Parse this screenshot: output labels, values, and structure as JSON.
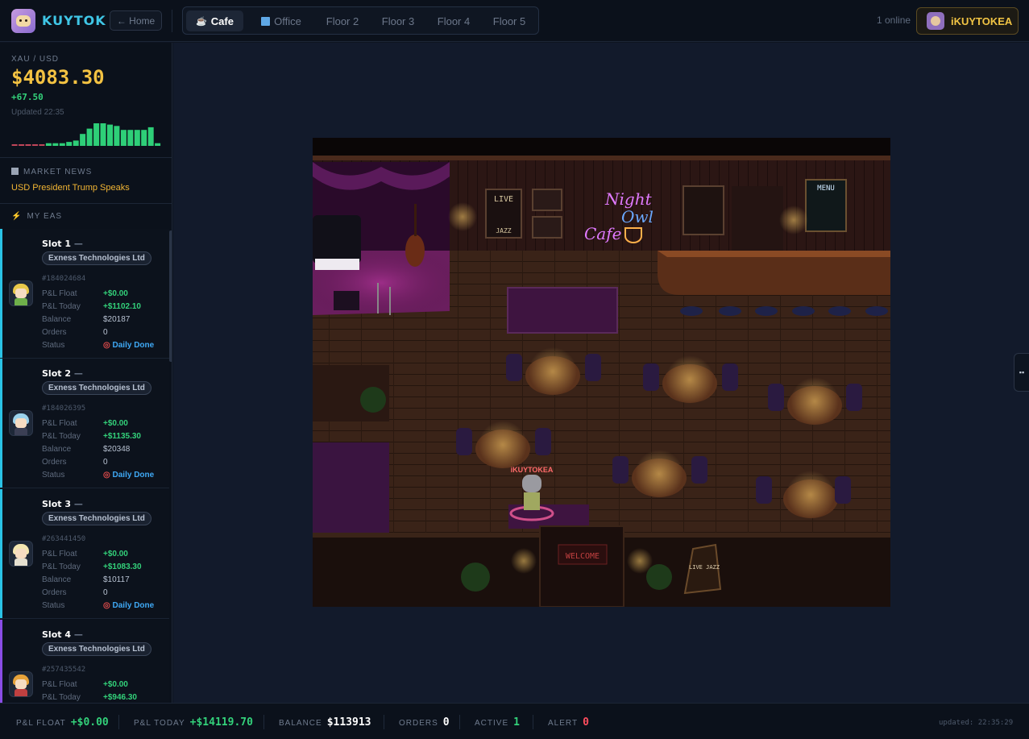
{
  "header": {
    "brand": "KUYTOK",
    "home_label": "← Home",
    "tabs": [
      {
        "label": "Cafe",
        "icon": "coffee-icon",
        "active": true
      },
      {
        "label": "Office",
        "icon": "building-icon"
      },
      {
        "label": "Floor 2"
      },
      {
        "label": "Floor 3"
      },
      {
        "label": "Floor 4"
      },
      {
        "label": "Floor 5"
      }
    ],
    "online": "1 online",
    "username": "iKUYTOKEA"
  },
  "ticker": {
    "symbol": "XAU / USD",
    "price": "$4083.30",
    "change": "+67.50",
    "updated": "Updated 22:35",
    "spark_values": [
      1,
      1,
      1,
      1,
      1,
      2,
      2,
      2,
      3,
      4,
      9,
      13,
      17,
      17,
      16,
      15,
      12,
      12,
      12,
      12,
      14,
      2
    ],
    "spark_colors": {
      "down": "#c0465a",
      "up": "#2ecf78"
    }
  },
  "news": {
    "title": "MARKET NEWS",
    "headline": "USD President Trump Speaks"
  },
  "eas": {
    "title": "MY EAS",
    "labels": {
      "float": "P&L Float",
      "today": "P&L Today",
      "balance": "Balance",
      "orders": "Orders",
      "status": "Status"
    },
    "slots": [
      {
        "name": "Slot 1",
        "broker": "Exness Technologies Ltd",
        "account": "#184024684",
        "float": "+$0.00",
        "today": "+$1102.10",
        "balance": "$20187",
        "orders": "0",
        "status": "Daily Done",
        "accent": "#2ac3e6"
      },
      {
        "name": "Slot 2",
        "broker": "Exness Technologies Ltd",
        "account": "#184026395",
        "float": "+$0.00",
        "today": "+$1135.30",
        "balance": "$20348",
        "orders": "0",
        "status": "Daily Done",
        "accent": "#2ac3e6"
      },
      {
        "name": "Slot 3",
        "broker": "Exness Technologies Ltd",
        "account": "#263441450",
        "float": "+$0.00",
        "today": "+$1083.30",
        "balance": "$10117",
        "orders": "0",
        "status": "Daily Done",
        "accent": "#2ac3e6"
      },
      {
        "name": "Slot 4",
        "broker": "Exness Technologies Ltd",
        "account": "#257435542",
        "float": "+$0.00",
        "today": "+$946.30",
        "accent": "#8a4de6"
      }
    ]
  },
  "scene": {
    "neon_line1": "Night",
    "neon_line2": "Owl",
    "neon_line3": "Cafe",
    "live_sign": "LIVE",
    "jazz_sign": "JAZZ",
    "menu_title": "MENU",
    "welcome_sign": "WELCOME",
    "easel_text": "LIVE JAZZ",
    "player_tag": "iKUYTOKEA"
  },
  "footer": {
    "float_label": "P&L FLOAT",
    "float_value": "+$0.00",
    "today_label": "P&L TODAY",
    "today_value": "+$14119.70",
    "balance_label": "BALANCE",
    "balance_value": "$113913",
    "orders_label": "ORDERS",
    "orders_value": "0",
    "active_label": "ACTIVE",
    "active_value": "1",
    "alert_label": "ALERT",
    "alert_value": "0",
    "updated": "updated: 22:35:29"
  }
}
